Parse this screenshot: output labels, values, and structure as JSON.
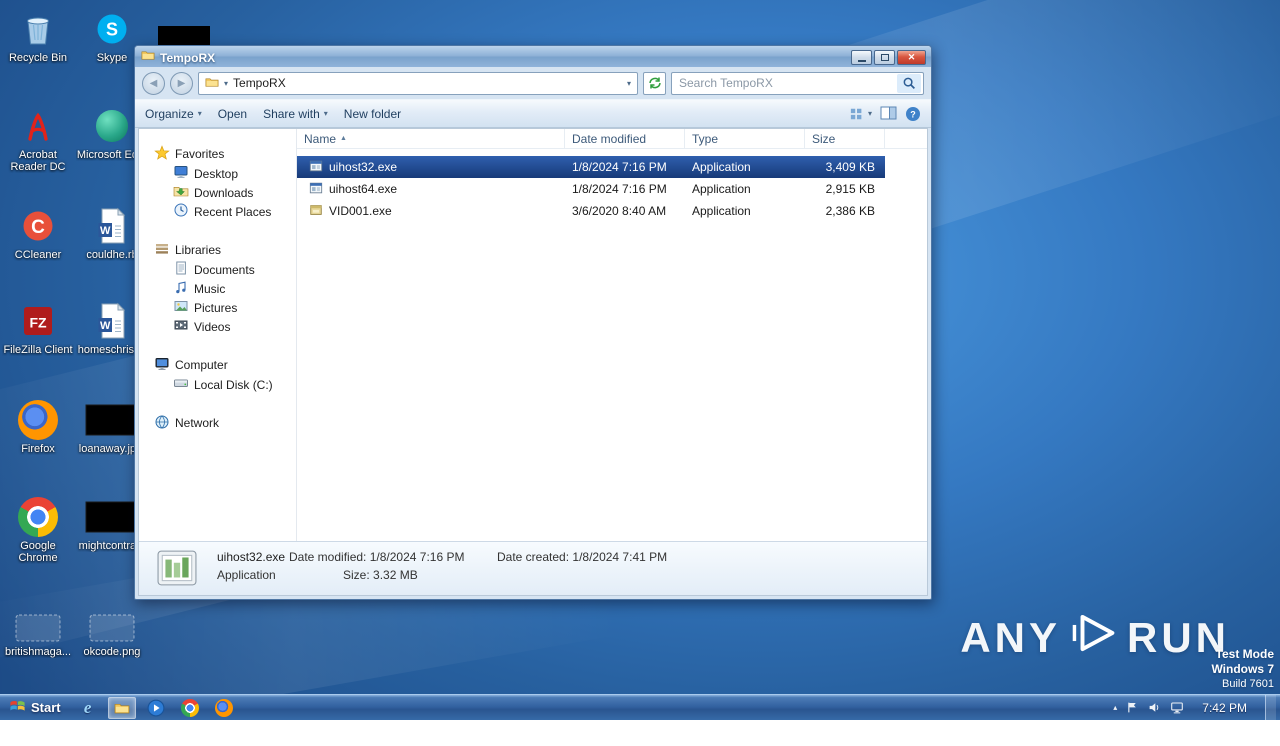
{
  "desktop": {
    "icons": [
      {
        "label": "Recycle Bin",
        "icon": "recycle-bin"
      },
      {
        "label": "Skype",
        "icon": "skype"
      },
      {
        "label": "Acrobat Reader DC",
        "icon": "acrobat"
      },
      {
        "label": "Microsoft Ed...",
        "icon": "edge"
      },
      {
        "label": "CCleaner",
        "icon": "ccleaner"
      },
      {
        "label": "couldhe.rb",
        "icon": "word-doc"
      },
      {
        "label": "FileZilla Client",
        "icon": "filezilla"
      },
      {
        "label": "homeschrist...",
        "icon": "word-doc"
      },
      {
        "label": "Firefox",
        "icon": "firefox"
      },
      {
        "label": "loanaway.jp...",
        "icon": "redacted-image"
      },
      {
        "label": "Google Chrome",
        "icon": "chrome"
      },
      {
        "label": "mightcontra...",
        "icon": "redacted-image"
      },
      {
        "label": "britishmaga...",
        "icon": "ghost"
      },
      {
        "label": "okcode.png",
        "icon": "ghost"
      }
    ],
    "watermark": {
      "brand_left": "ANY",
      "brand_right": "RUN",
      "mode": "Test Mode",
      "os": "Windows 7",
      "build": "Build 7601"
    }
  },
  "explorer": {
    "title": "TempoRX",
    "nav": {
      "breadcrumb": "TempoRX",
      "search_placeholder": "Search TempoRX"
    },
    "toolbar": {
      "organize": "Organize",
      "open": "Open",
      "share_with": "Share with",
      "new_folder": "New folder"
    },
    "sidebar": {
      "groups": [
        {
          "label": "Favorites",
          "icon": "favorites-star",
          "items": [
            {
              "label": "Desktop",
              "icon": "desktop"
            },
            {
              "label": "Downloads",
              "icon": "downloads"
            },
            {
              "label": "Recent Places",
              "icon": "recent-places"
            }
          ]
        },
        {
          "label": "Libraries",
          "icon": "libraries",
          "items": [
            {
              "label": "Documents",
              "icon": "documents"
            },
            {
              "label": "Music",
              "icon": "music"
            },
            {
              "label": "Pictures",
              "icon": "pictures"
            },
            {
              "label": "Videos",
              "icon": "videos"
            }
          ]
        },
        {
          "label": "Computer",
          "icon": "computer",
          "items": [
            {
              "label": "Local Disk (C:)",
              "icon": "local-disk"
            }
          ]
        },
        {
          "label": "Network",
          "icon": "network",
          "items": []
        }
      ]
    },
    "list": {
      "columns": [
        "Name",
        "Date modified",
        "Type",
        "Size"
      ],
      "files": [
        {
          "name": "uihost32.exe",
          "modified": "1/8/2024 7:16 PM",
          "type": "Application",
          "size": "3,409 KB",
          "icon": "app-exe",
          "selected": true
        },
        {
          "name": "uihost64.exe",
          "modified": "1/8/2024 7:16 PM",
          "type": "Application",
          "size": "2,915 KB",
          "icon": "app-exe",
          "selected": false
        },
        {
          "name": "VID001.exe",
          "modified": "3/6/2020 8:40 AM",
          "type": "Application",
          "size": "2,386 KB",
          "icon": "installer",
          "selected": false
        }
      ]
    },
    "details": {
      "name": "uihost32.exe",
      "type": "Application",
      "date_modified_label": "Date modified:",
      "date_modified": "1/8/2024 7:16 PM",
      "size_label": "Size:",
      "size": "3.32 MB",
      "date_created_label": "Date created:",
      "date_created": "1/8/2024 7:41 PM"
    }
  },
  "taskbar": {
    "start_label": "Start",
    "time": "7:42 PM",
    "apps": [
      {
        "icon": "ie"
      },
      {
        "icon": "explorer",
        "active": true
      },
      {
        "icon": "media-player"
      },
      {
        "icon": "chrome"
      },
      {
        "icon": "firefox"
      }
    ]
  },
  "colors": {
    "selection": "#1c3e7e",
    "taskbar": "#31609f",
    "wallpaper": "#3579c2"
  }
}
